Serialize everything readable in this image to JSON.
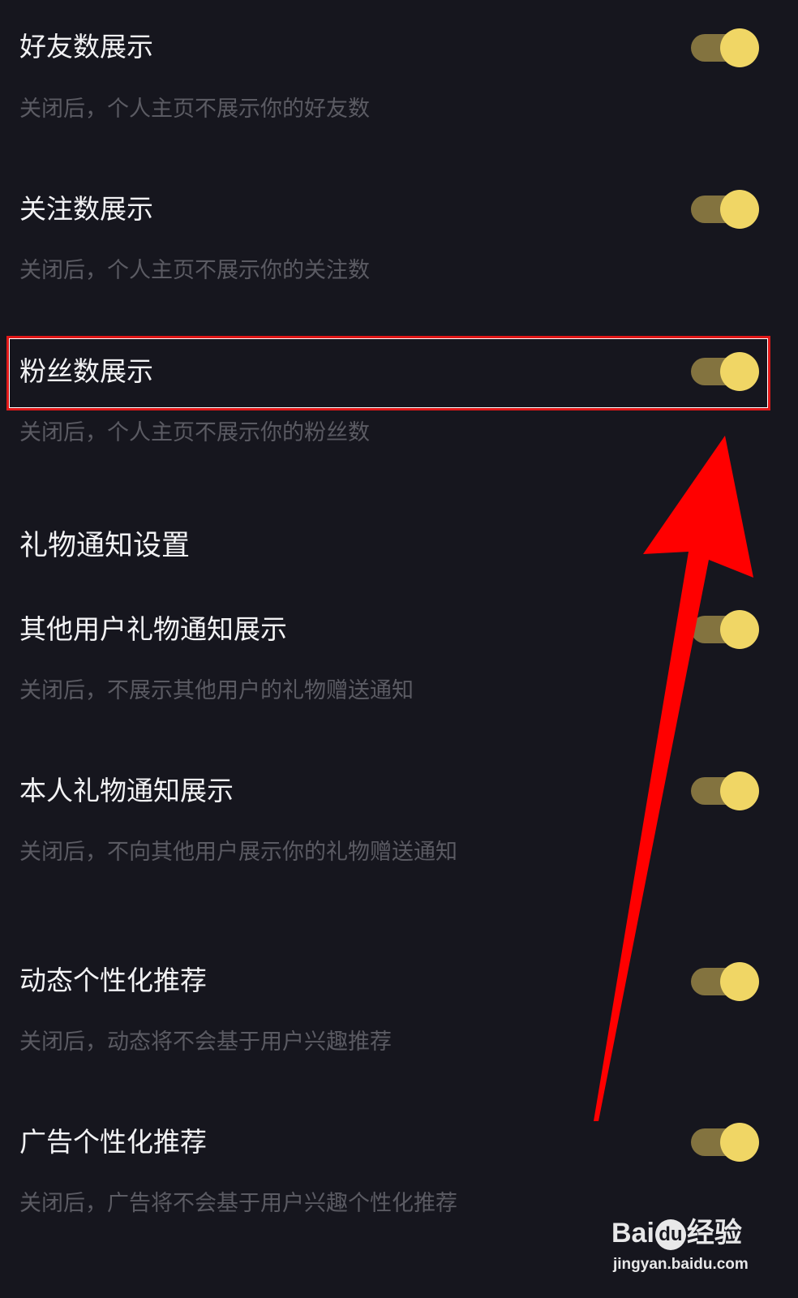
{
  "settings": [
    {
      "title": "好友数展示",
      "description": "关闭后，个人主页不展示你的好友数",
      "enabled": true
    },
    {
      "title": "关注数展示",
      "description": "关闭后，个人主页不展示你的关注数",
      "enabled": true
    },
    {
      "title": "粉丝数展示",
      "description": "关闭后，个人主页不展示你的粉丝数",
      "enabled": true
    }
  ],
  "gift_section": {
    "title": "礼物通知设置",
    "items": [
      {
        "title": "其他用户礼物通知展示",
        "description": "关闭后，不展示其他用户的礼物赠送通知",
        "enabled": true
      },
      {
        "title": "本人礼物通知展示",
        "description": "关闭后，不向其他用户展示你的礼物赠送通知",
        "enabled": true
      }
    ]
  },
  "personalization": [
    {
      "title": "动态个性化推荐",
      "description": "关闭后，动态将不会基于用户兴趣推荐",
      "enabled": true
    },
    {
      "title": "广告个性化推荐",
      "description": "关闭后，广告将不会基于用户兴趣个性化推荐",
      "enabled": true
    }
  ],
  "annotation": {
    "highlight_color": "#e01818",
    "arrow_color": "#ff0000"
  },
  "watermark": {
    "logo_prefix": "Bai",
    "logo_mark": "du",
    "logo_suffix": "经验",
    "url": "jingyan.baidu.com"
  },
  "colors": {
    "background": "#16161e",
    "title_text": "#f2f2f4",
    "description_text": "#5b5b63",
    "toggle_track": "#83733f",
    "toggle_knob": "#f0d665"
  }
}
